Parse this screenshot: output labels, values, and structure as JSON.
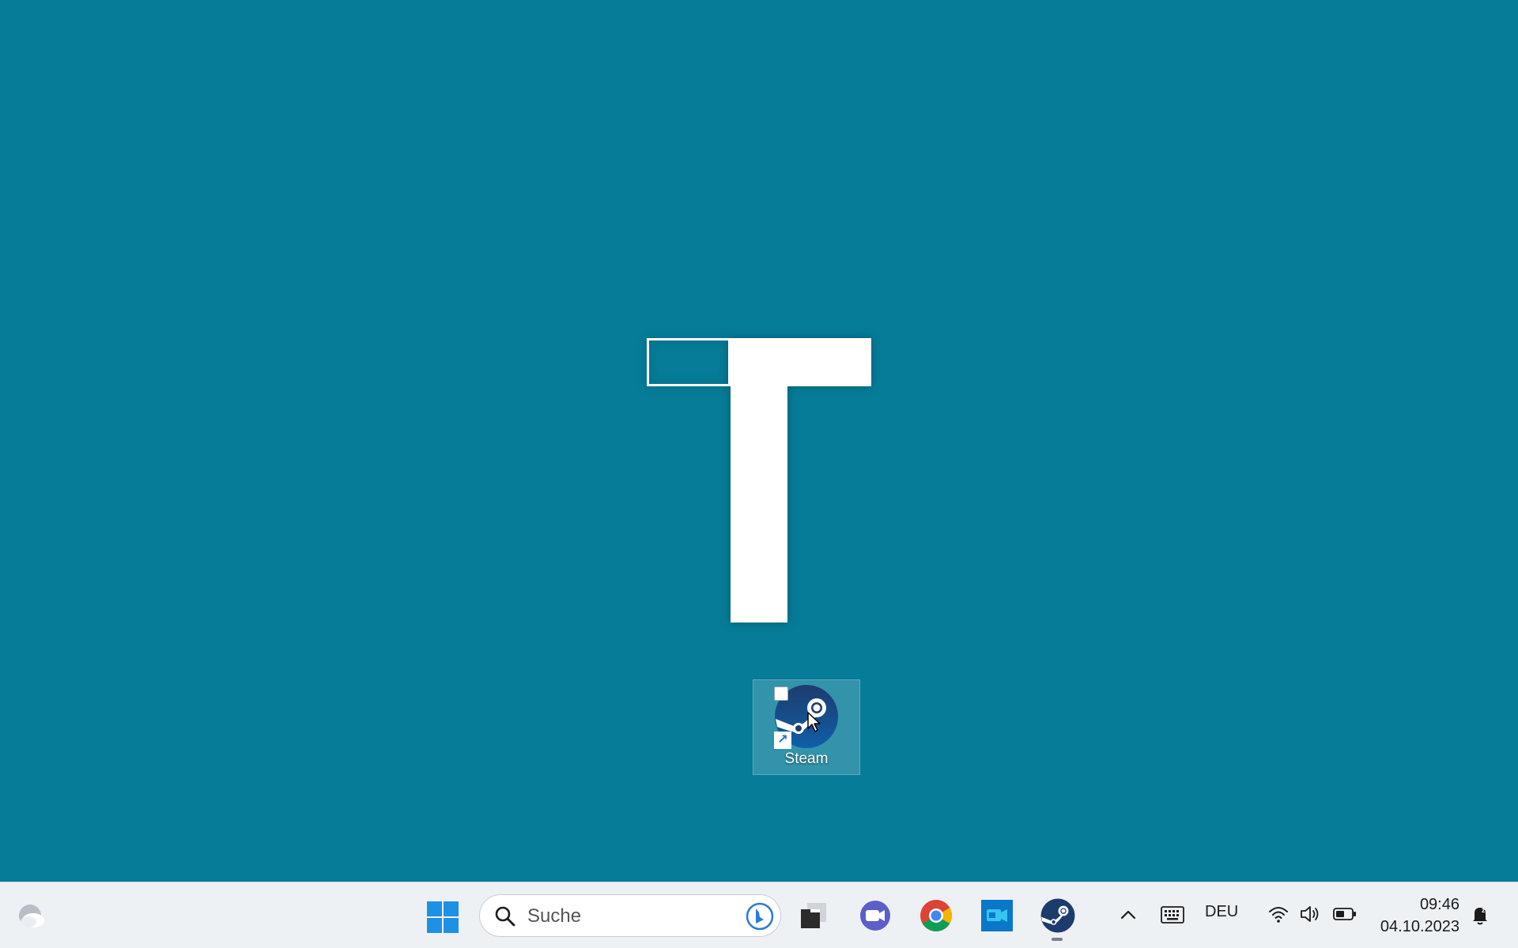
{
  "desktop": {
    "background_color": "#067c98",
    "logo": {
      "letter_shape": "T",
      "color": "#ffffff"
    },
    "icons": [
      {
        "label": "Steam",
        "icon": "steam-icon",
        "shortcut": true,
        "selected": true
      }
    ]
  },
  "taskbar": {
    "weather_widget": {
      "icon": "weather-cloud-icon"
    },
    "start_button": {
      "icon": "windows-logo-icon"
    },
    "search": {
      "placeholder": "Suche",
      "icon": "search-icon",
      "bing_icon": "bing-icon"
    },
    "pinned_apps": [
      {
        "name": "Task View",
        "icon": "task-view-icon"
      },
      {
        "name": "Teams",
        "icon": "teams-icon"
      },
      {
        "name": "Google Chrome",
        "icon": "chrome-icon"
      },
      {
        "name": "Meet",
        "icon": "meet-icon"
      },
      {
        "name": "Steam",
        "icon": "steam-icon",
        "running": true
      }
    ],
    "tray": {
      "overflow_icon": "chevron-up-icon",
      "keyboard_icon": "keyboard-icon",
      "language": "DEU",
      "wifi_icon": "wifi-icon",
      "volume_icon": "volume-icon",
      "battery_icon": "battery-icon",
      "time": "09:46",
      "date": "04.10.2023",
      "notification_icon": "notification-bell-icon"
    }
  }
}
